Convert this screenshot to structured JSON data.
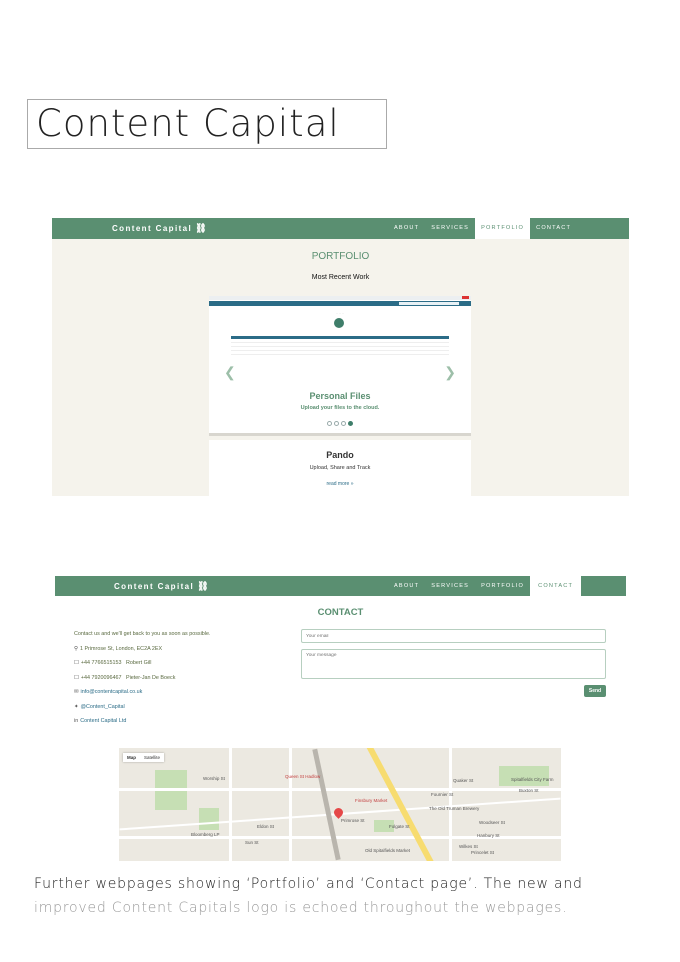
{
  "page": {
    "title": "Content Capital",
    "caption_line1": "Further webpages showing ‘Portfolio’ and ‘Contact page’. The new and",
    "caption_line2": "improved Content Capitals logo is echoed throughout the webpages."
  },
  "colors": {
    "brand_green": "#5a8f71",
    "page_bg": "#f5f3ec",
    "link_blue": "#2b6c87"
  },
  "portfolio_site": {
    "logo": "Content Capital",
    "logo_icon": "link-icon",
    "nav": [
      "ABOUT",
      "SERVICES",
      "PORTFOLIO",
      "CONTACT"
    ],
    "active_nav": "PORTFOLIO",
    "heading": "PORTFOLIO",
    "subheading": "Most Recent Work",
    "slide": {
      "title": "Personal Files",
      "description": "Upload your files to the cloud."
    },
    "project": {
      "title": "Pando",
      "description": "Upload, Share and Track",
      "link": "read more »"
    }
  },
  "contact_site": {
    "logo": "Content Capital",
    "nav": [
      "ABOUT",
      "SERVICES",
      "PORTFOLIO",
      "CONTACT"
    ],
    "active_nav": "CONTACT",
    "heading": "CONTACT",
    "intro": "Contact us and we'll get back to you as soon as possible.",
    "address": "1 Primrose St, London, EC2A 2EX",
    "phones": [
      {
        "number": "+44  7766515153",
        "name": "Robert Gill"
      },
      {
        "number": "+44  7920096467",
        "name": "Pieter-Jan De Boeck"
      }
    ],
    "email": "info@contentcapital.co.uk",
    "twitter": "@Content_Capital",
    "linkedin": "Content Capital Ltd",
    "form": {
      "email_placeholder": "Your email",
      "message_placeholder": "Your message",
      "send_label": "Send"
    }
  },
  "map": {
    "tabs": [
      "Map",
      "Satellite"
    ],
    "labels": [
      "Worship St",
      "Queen St Hadlow",
      "Quaker St",
      "Primrose St",
      "Finsbury Market",
      "Bloomberg LP",
      "Old Spitalfields Market",
      "The Old Truman Brewery",
      "Woodseer St",
      "Hanbury St",
      "Princelet St",
      "Sun St",
      "Eldon St",
      "Spitalfields City Farm",
      "Buxton St",
      "Fournier St",
      "Folgate St",
      "Wilkes St"
    ]
  }
}
